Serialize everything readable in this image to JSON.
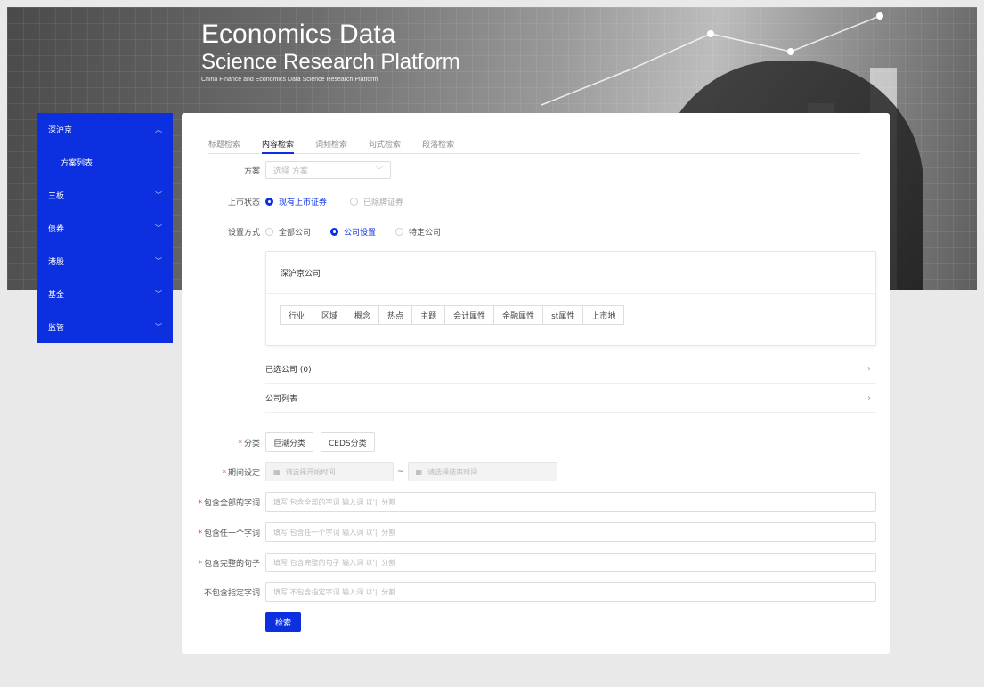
{
  "banner": {
    "title1": "Economics Data",
    "title2": "Science Research Platform",
    "subtitle": "China Finance and Economics Data Science Research Platform"
  },
  "sidebar": {
    "items": [
      {
        "label": "深沪京",
        "expanded": true,
        "children": [
          {
            "label": "方案列表"
          }
        ]
      },
      {
        "label": "三板"
      },
      {
        "label": "债券"
      },
      {
        "label": "港股"
      },
      {
        "label": "基金"
      },
      {
        "label": "监管"
      }
    ],
    "color": "#0c2fe0"
  },
  "tabs": [
    "标题检索",
    "内容检索",
    "词频检索",
    "句式检索",
    "段落检索"
  ],
  "active_tab": "内容检索",
  "form": {
    "plan_label": "方案",
    "plan_placeholder": "选择 方案",
    "listing_label": "上市状态",
    "listing_options": [
      "现有上市证券",
      "已除牌证券"
    ],
    "setting_label": "设置方式",
    "setting_options": [
      "全部公司",
      "公司设置",
      "特定公司"
    ],
    "company_box_title": "深沪京公司",
    "attr_tabs": [
      "行业",
      "区域",
      "概念",
      "热点",
      "主题",
      "会计属性",
      "金融属性",
      "st属性",
      "上市地"
    ],
    "selected_companies": "已选公司 (0)",
    "company_list": "公司列表",
    "category_label": "分类",
    "category_buttons": [
      "巨潮分类",
      "CEDS分类"
    ],
    "period_label": "期间设定",
    "start_placeholder": "请选择开始时间",
    "end_placeholder": "请选择结束时间",
    "tilde": "~",
    "all_words_label": "包含全部的字词",
    "all_words_placeholder": "填写 包含全部的字词 输入词 以'|' 分割",
    "any_word_label": "包含任一个字词",
    "any_word_placeholder": "填写 包含任一个字词 输入词 以'|' 分割",
    "sentence_label": "包含完整的句子",
    "sentence_placeholder": "填写 包含完整的句子 输入词 以'|' 分割",
    "exclude_label": "不包含指定字词",
    "exclude_placeholder": "填写 不包含指定字词 输入词 以'|' 分割",
    "search_button": "检索",
    "required_mark": "*"
  },
  "icons": {
    "chevron_up": "︿",
    "chevron_down": "﹀",
    "chevron_right": "›",
    "calendar": "▦"
  }
}
